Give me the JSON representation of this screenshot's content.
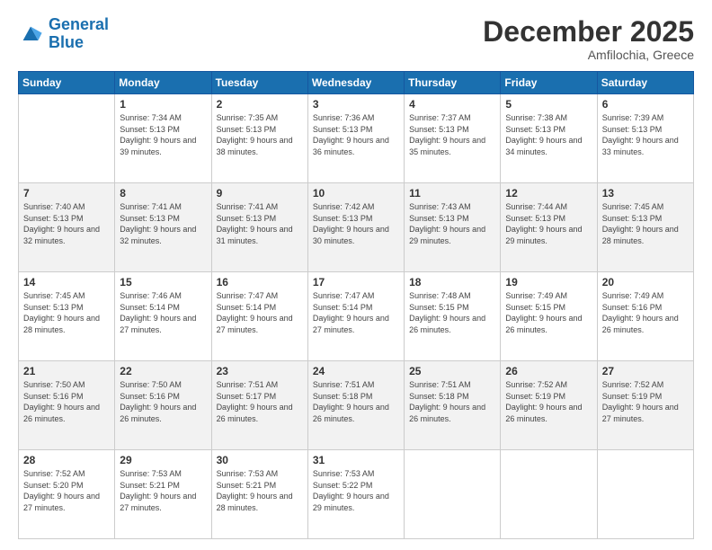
{
  "logo": {
    "line1": "General",
    "line2": "Blue"
  },
  "header": {
    "month": "December 2025",
    "location": "Amfilochia, Greece"
  },
  "days_of_week": [
    "Sunday",
    "Monday",
    "Tuesday",
    "Wednesday",
    "Thursday",
    "Friday",
    "Saturday"
  ],
  "weeks": [
    [
      {
        "day": "",
        "sunrise": "",
        "sunset": "",
        "daylight": ""
      },
      {
        "day": "1",
        "sunrise": "Sunrise: 7:34 AM",
        "sunset": "Sunset: 5:13 PM",
        "daylight": "Daylight: 9 hours and 39 minutes."
      },
      {
        "day": "2",
        "sunrise": "Sunrise: 7:35 AM",
        "sunset": "Sunset: 5:13 PM",
        "daylight": "Daylight: 9 hours and 38 minutes."
      },
      {
        "day": "3",
        "sunrise": "Sunrise: 7:36 AM",
        "sunset": "Sunset: 5:13 PM",
        "daylight": "Daylight: 9 hours and 36 minutes."
      },
      {
        "day": "4",
        "sunrise": "Sunrise: 7:37 AM",
        "sunset": "Sunset: 5:13 PM",
        "daylight": "Daylight: 9 hours and 35 minutes."
      },
      {
        "day": "5",
        "sunrise": "Sunrise: 7:38 AM",
        "sunset": "Sunset: 5:13 PM",
        "daylight": "Daylight: 9 hours and 34 minutes."
      },
      {
        "day": "6",
        "sunrise": "Sunrise: 7:39 AM",
        "sunset": "Sunset: 5:13 PM",
        "daylight": "Daylight: 9 hours and 33 minutes."
      }
    ],
    [
      {
        "day": "7",
        "sunrise": "Sunrise: 7:40 AM",
        "sunset": "Sunset: 5:13 PM",
        "daylight": "Daylight: 9 hours and 32 minutes."
      },
      {
        "day": "8",
        "sunrise": "Sunrise: 7:41 AM",
        "sunset": "Sunset: 5:13 PM",
        "daylight": "Daylight: 9 hours and 32 minutes."
      },
      {
        "day": "9",
        "sunrise": "Sunrise: 7:41 AM",
        "sunset": "Sunset: 5:13 PM",
        "daylight": "Daylight: 9 hours and 31 minutes."
      },
      {
        "day": "10",
        "sunrise": "Sunrise: 7:42 AM",
        "sunset": "Sunset: 5:13 PM",
        "daylight": "Daylight: 9 hours and 30 minutes."
      },
      {
        "day": "11",
        "sunrise": "Sunrise: 7:43 AM",
        "sunset": "Sunset: 5:13 PM",
        "daylight": "Daylight: 9 hours and 29 minutes."
      },
      {
        "day": "12",
        "sunrise": "Sunrise: 7:44 AM",
        "sunset": "Sunset: 5:13 PM",
        "daylight": "Daylight: 9 hours and 29 minutes."
      },
      {
        "day": "13",
        "sunrise": "Sunrise: 7:45 AM",
        "sunset": "Sunset: 5:13 PM",
        "daylight": "Daylight: 9 hours and 28 minutes."
      }
    ],
    [
      {
        "day": "14",
        "sunrise": "Sunrise: 7:45 AM",
        "sunset": "Sunset: 5:13 PM",
        "daylight": "Daylight: 9 hours and 28 minutes."
      },
      {
        "day": "15",
        "sunrise": "Sunrise: 7:46 AM",
        "sunset": "Sunset: 5:14 PM",
        "daylight": "Daylight: 9 hours and 27 minutes."
      },
      {
        "day": "16",
        "sunrise": "Sunrise: 7:47 AM",
        "sunset": "Sunset: 5:14 PM",
        "daylight": "Daylight: 9 hours and 27 minutes."
      },
      {
        "day": "17",
        "sunrise": "Sunrise: 7:47 AM",
        "sunset": "Sunset: 5:14 PM",
        "daylight": "Daylight: 9 hours and 27 minutes."
      },
      {
        "day": "18",
        "sunrise": "Sunrise: 7:48 AM",
        "sunset": "Sunset: 5:15 PM",
        "daylight": "Daylight: 9 hours and 26 minutes."
      },
      {
        "day": "19",
        "sunrise": "Sunrise: 7:49 AM",
        "sunset": "Sunset: 5:15 PM",
        "daylight": "Daylight: 9 hours and 26 minutes."
      },
      {
        "day": "20",
        "sunrise": "Sunrise: 7:49 AM",
        "sunset": "Sunset: 5:16 PM",
        "daylight": "Daylight: 9 hours and 26 minutes."
      }
    ],
    [
      {
        "day": "21",
        "sunrise": "Sunrise: 7:50 AM",
        "sunset": "Sunset: 5:16 PM",
        "daylight": "Daylight: 9 hours and 26 minutes."
      },
      {
        "day": "22",
        "sunrise": "Sunrise: 7:50 AM",
        "sunset": "Sunset: 5:16 PM",
        "daylight": "Daylight: 9 hours and 26 minutes."
      },
      {
        "day": "23",
        "sunrise": "Sunrise: 7:51 AM",
        "sunset": "Sunset: 5:17 PM",
        "daylight": "Daylight: 9 hours and 26 minutes."
      },
      {
        "day": "24",
        "sunrise": "Sunrise: 7:51 AM",
        "sunset": "Sunset: 5:18 PM",
        "daylight": "Daylight: 9 hours and 26 minutes."
      },
      {
        "day": "25",
        "sunrise": "Sunrise: 7:51 AM",
        "sunset": "Sunset: 5:18 PM",
        "daylight": "Daylight: 9 hours and 26 minutes."
      },
      {
        "day": "26",
        "sunrise": "Sunrise: 7:52 AM",
        "sunset": "Sunset: 5:19 PM",
        "daylight": "Daylight: 9 hours and 26 minutes."
      },
      {
        "day": "27",
        "sunrise": "Sunrise: 7:52 AM",
        "sunset": "Sunset: 5:19 PM",
        "daylight": "Daylight: 9 hours and 27 minutes."
      }
    ],
    [
      {
        "day": "28",
        "sunrise": "Sunrise: 7:52 AM",
        "sunset": "Sunset: 5:20 PM",
        "daylight": "Daylight: 9 hours and 27 minutes."
      },
      {
        "day": "29",
        "sunrise": "Sunrise: 7:53 AM",
        "sunset": "Sunset: 5:21 PM",
        "daylight": "Daylight: 9 hours and 27 minutes."
      },
      {
        "day": "30",
        "sunrise": "Sunrise: 7:53 AM",
        "sunset": "Sunset: 5:21 PM",
        "daylight": "Daylight: 9 hours and 28 minutes."
      },
      {
        "day": "31",
        "sunrise": "Sunrise: 7:53 AM",
        "sunset": "Sunset: 5:22 PM",
        "daylight": "Daylight: 9 hours and 29 minutes."
      },
      {
        "day": "",
        "sunrise": "",
        "sunset": "",
        "daylight": ""
      },
      {
        "day": "",
        "sunrise": "",
        "sunset": "",
        "daylight": ""
      },
      {
        "day": "",
        "sunrise": "",
        "sunset": "",
        "daylight": ""
      }
    ]
  ]
}
